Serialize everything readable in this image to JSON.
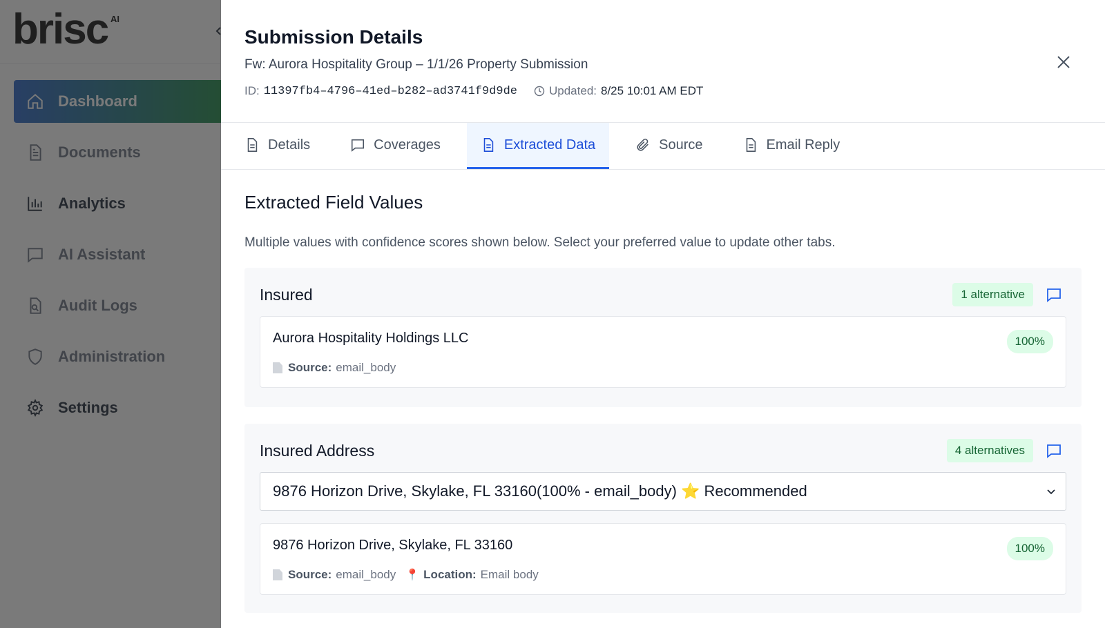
{
  "sidebar": {
    "logo": "brisc",
    "logo_suffix": "AI",
    "items": [
      {
        "label": "Dashboard",
        "icon": "home-icon",
        "active": true
      },
      {
        "label": "Documents",
        "icon": "document-icon"
      },
      {
        "label": "Analytics",
        "icon": "bar-chart-icon"
      },
      {
        "label": "AI Assistant",
        "icon": "chat-icon"
      },
      {
        "label": "Audit Logs",
        "icon": "file-search-icon"
      },
      {
        "label": "Administration",
        "icon": "shield-icon"
      },
      {
        "label": "Settings",
        "icon": "gear-icon"
      }
    ]
  },
  "modal": {
    "title": "Submission Details",
    "subtitle": "Fw: Aurora Hospitality Group – 1/1/26 Property Submission",
    "id_label": "ID:",
    "id_value": "11397fb4–4796–41ed–b282–ad3741f9d9de",
    "updated_label": "Updated:",
    "updated_value": "8/25 10:01 AM EDT"
  },
  "tabs": [
    {
      "label": "Details",
      "icon": "document-icon"
    },
    {
      "label": "Coverages",
      "icon": "chat-icon"
    },
    {
      "label": "Extracted Data",
      "icon": "document-icon",
      "active": true
    },
    {
      "label": "Source",
      "icon": "paperclip-icon"
    },
    {
      "label": "Email Reply",
      "icon": "document-icon"
    }
  ],
  "extracted": {
    "title": "Extracted Field Values",
    "description": "Multiple values with confidence scores shown below. Select your preferred value to update other tabs.",
    "fields": [
      {
        "name": "Insured",
        "alternatives": "1 alternative",
        "value": "Aurora Hospitality Holdings LLC",
        "confidence": "100%",
        "source_label": "Source:",
        "source": "email_body"
      },
      {
        "name": "Insured Address",
        "alternatives": "4 alternatives",
        "selected_option": "9876 Horizon Drive, Skylake, FL 33160(100% - email_body) ⭐ Recommended",
        "value": "9876 Horizon Drive, Skylake, FL 33160",
        "confidence": "100%",
        "source_label": "Source:",
        "source": "email_body",
        "location_label": "Location:",
        "location": "Email body"
      }
    ]
  },
  "colors": {
    "accent": "#2563eb",
    "nav_gradient_start": "#2a64c6",
    "nav_gradient_end": "#1f8a48",
    "badge_bg": "#dcfce7",
    "badge_text": "#166534"
  }
}
